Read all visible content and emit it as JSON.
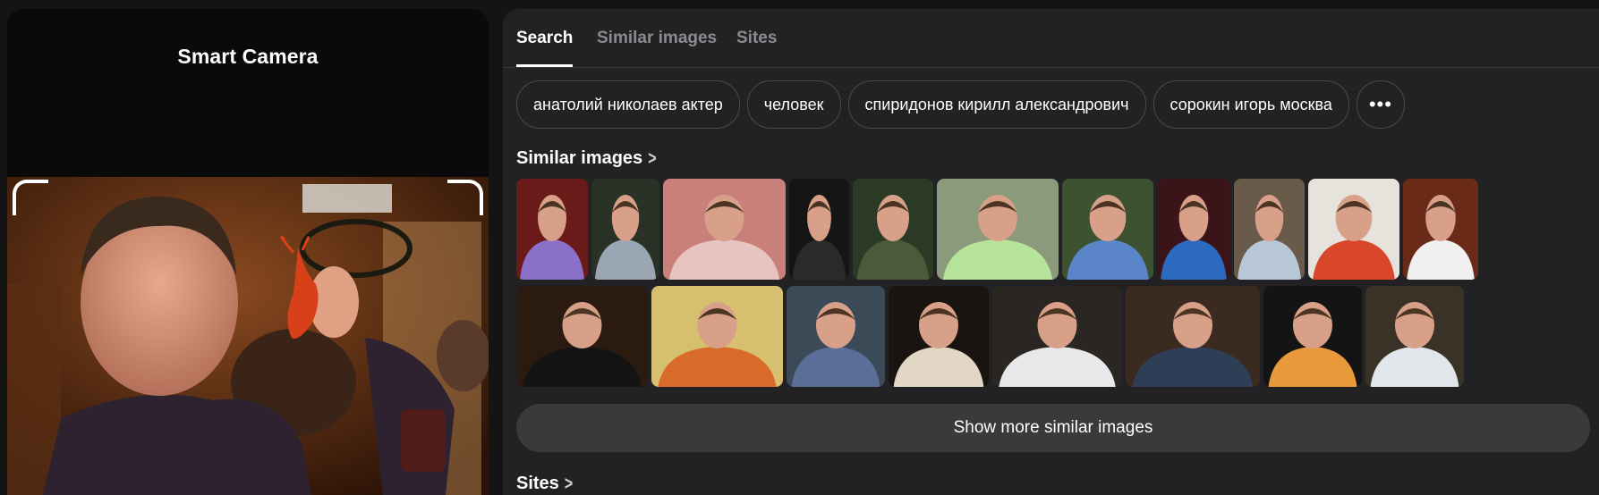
{
  "left_panel": {
    "title": "Smart Camera"
  },
  "tabs": [
    {
      "label": "Search",
      "active": true
    },
    {
      "label": "Similar images",
      "active": false
    },
    {
      "label": "Sites",
      "active": false
    }
  ],
  "chips": [
    {
      "label": "анатолий николаев актер"
    },
    {
      "label": "человек"
    },
    {
      "label": "спиридонов кирилл александрович"
    },
    {
      "label": "сорокин игорь москва"
    }
  ],
  "more_chip_icon": "more-horizontal-icon",
  "similar_images": {
    "title": "Similar images",
    "show_more_label": "Show more similar images",
    "row1": [
      {
        "bg": "#6a1a18",
        "shirt": "#8a70c8"
      },
      {
        "bg": "#2a3228",
        "shirt": "#9aa6b2"
      },
      {
        "bg": "#c9807a",
        "shirt": "#e8c4c0"
      },
      {
        "bg": "#151515",
        "shirt": "#2a2a2a"
      },
      {
        "bg": "#2b3a24",
        "shirt": "#4a5a3a"
      },
      {
        "bg": "#8a9a7a",
        "shirt": "#b6e49a"
      },
      {
        "bg": "#3c5230",
        "shirt": "#5a86c9"
      },
      {
        "bg": "#3a1418",
        "shirt": "#2c6ac0"
      },
      {
        "bg": "#6a5a4a",
        "shirt": "#b8c8d8"
      },
      {
        "bg": "#e6e2dc",
        "shirt": "#d9472a"
      },
      {
        "bg": "#6a2a18",
        "shirt": "#f0f0f0"
      }
    ],
    "row2": [
      {
        "bg": "#2a1a10",
        "shirt": "#141414"
      },
      {
        "bg": "#d6c070",
        "shirt": "#d86a2a"
      },
      {
        "bg": "#3a4a56",
        "shirt": "#5a6e98"
      },
      {
        "bg": "#1a1410",
        "shirt": "#e2d6c4"
      },
      {
        "bg": "#2a2622",
        "shirt": "#e8e8ea"
      },
      {
        "bg": "#3a2a20",
        "shirt": "#2e3e56"
      },
      {
        "bg": "#141414",
        "shirt": "#e89a3a"
      },
      {
        "bg": "#3a3226",
        "shirt": "#e0e6ea"
      }
    ]
  },
  "sites": {
    "title": "Sites"
  }
}
